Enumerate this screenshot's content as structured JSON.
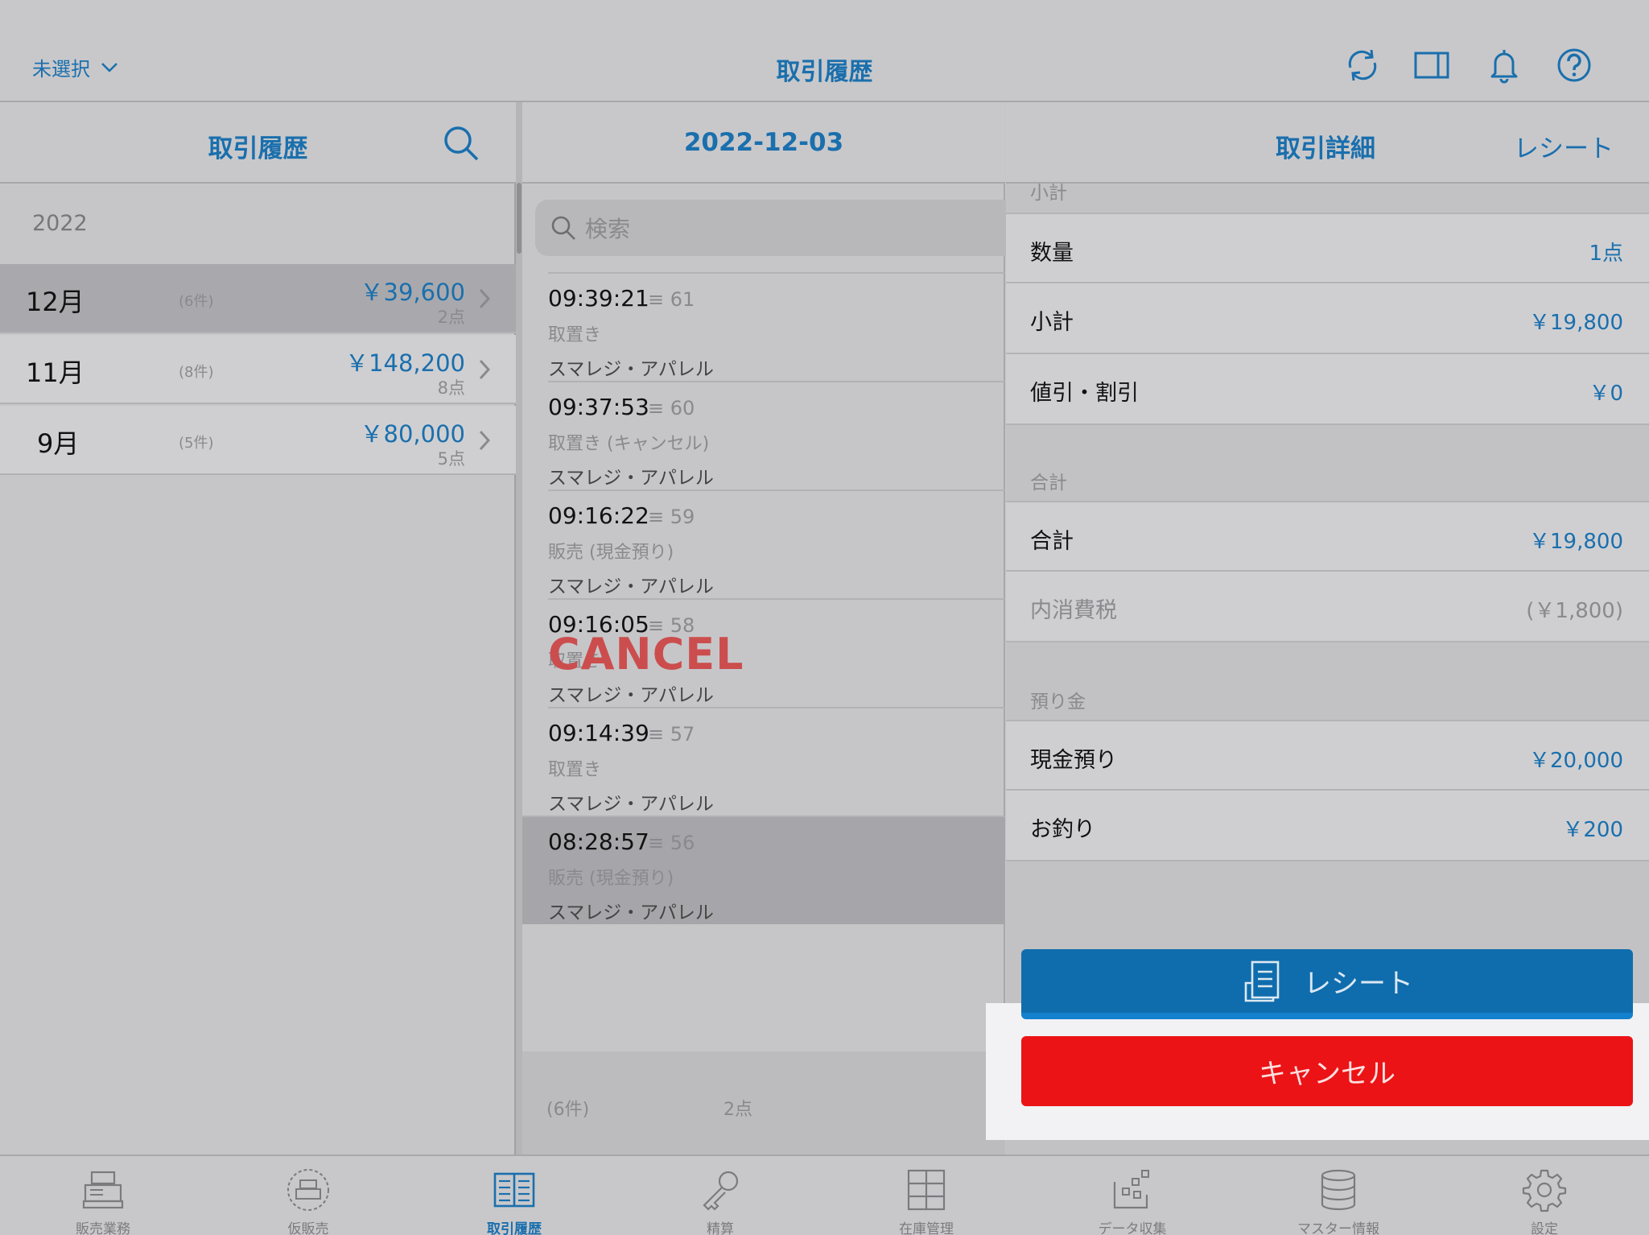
{
  "colors": {
    "accent": "#1a6fad",
    "cancel_button": "#eb1316",
    "receipt_button": "#0f6dad",
    "cancel_mark": "#cc4d4d"
  },
  "topbar": {
    "store_selector": "未選択",
    "title": "取引履歴",
    "icons": [
      "refresh-icon",
      "split-view-icon",
      "bell-icon",
      "help-icon"
    ]
  },
  "left": {
    "header": "取引履歴",
    "year": "2022",
    "months": [
      {
        "month": "12月",
        "count": "(6件)",
        "amount": "￥39,600",
        "points": "2点",
        "selected": true
      },
      {
        "month": "11月",
        "count": "(8件)",
        "amount": "￥148,200",
        "points": "8点",
        "selected": false
      },
      {
        "month": "9月",
        "count": "(5件)",
        "amount": "￥80,000",
        "points": "5点",
        "selected": false
      }
    ]
  },
  "middle": {
    "header": "2022-12-03",
    "search_placeholder": "検索",
    "transactions": [
      {
        "time": "09:39:21",
        "number": "61",
        "kind": "取置き",
        "shop": "スマレジ・アパレル"
      },
      {
        "time": "09:37:53",
        "number": "60",
        "kind": "取置き (キャンセル)",
        "shop": "スマレジ・アパレル"
      },
      {
        "time": "09:16:22",
        "number": "59",
        "kind": "販売 (現金預り)",
        "shop": "スマレジ・アパレル"
      },
      {
        "time": "09:16:05",
        "number": "58",
        "kind": "取置き",
        "shop": "スマレジ・アパレル",
        "mark": "CANCEL"
      },
      {
        "time": "09:14:39",
        "number": "57",
        "kind": "取置き",
        "shop": "スマレジ・アパレル"
      },
      {
        "time": "08:28:57",
        "number": "56",
        "kind": "販売 (現金預り)",
        "shop": "スマレジ・アパレル",
        "selected": true
      }
    ],
    "footer_count": "(6件)",
    "footer_points": "2点"
  },
  "right": {
    "header": "取引詳細",
    "receipt_link": "レシート",
    "section_subtotal": "小計",
    "rows_subtotal": [
      {
        "label": "数量",
        "value": "1点"
      },
      {
        "label": "小計",
        "value": "￥19,800"
      },
      {
        "label": "値引・割引",
        "value": "￥0"
      }
    ],
    "section_total": "合計",
    "rows_total": [
      {
        "label": "合計",
        "value": "￥19,800"
      },
      {
        "label": "内消費税",
        "value": "(￥1,800)"
      }
    ],
    "section_deposit": "預り金",
    "rows_deposit": [
      {
        "label": "現金預り",
        "value": "￥20,000"
      },
      {
        "label": "お釣り",
        "value": "￥200"
      }
    ],
    "receipt_button": "レシート",
    "cancel_button": "キャンセル"
  },
  "tabs": [
    {
      "label": "販売業務",
      "icon": "register-icon"
    },
    {
      "label": "仮販売",
      "icon": "temp-register-icon"
    },
    {
      "label": "取引履歴",
      "icon": "history-book-icon",
      "active": true
    },
    {
      "label": "精算",
      "icon": "key-icon"
    },
    {
      "label": "在庫管理",
      "icon": "stock-shelf-icon"
    },
    {
      "label": "データ収集",
      "icon": "data-collect-icon"
    },
    {
      "label": "マスター情報",
      "icon": "database-icon"
    },
    {
      "label": "設定",
      "icon": "gear-icon"
    }
  ]
}
